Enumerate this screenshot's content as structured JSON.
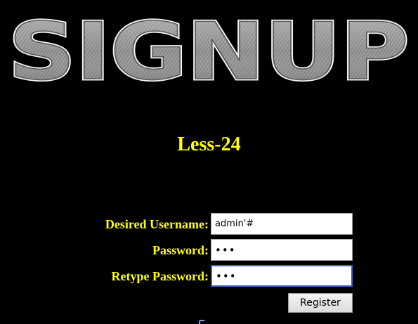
{
  "header": {
    "logo_text": "SIGNUP"
  },
  "main": {
    "title": "Less-24"
  },
  "form": {
    "username_label": "Desired Username:",
    "username_value": "admin'#",
    "password_label": "Password:",
    "password_value": "abc",
    "retype_label": "Retype Password:",
    "retype_value": "abc",
    "register_label": "Register"
  },
  "colors": {
    "background": "#000000",
    "label_text": "#ffff00",
    "focus_border": "#3a62c8"
  }
}
